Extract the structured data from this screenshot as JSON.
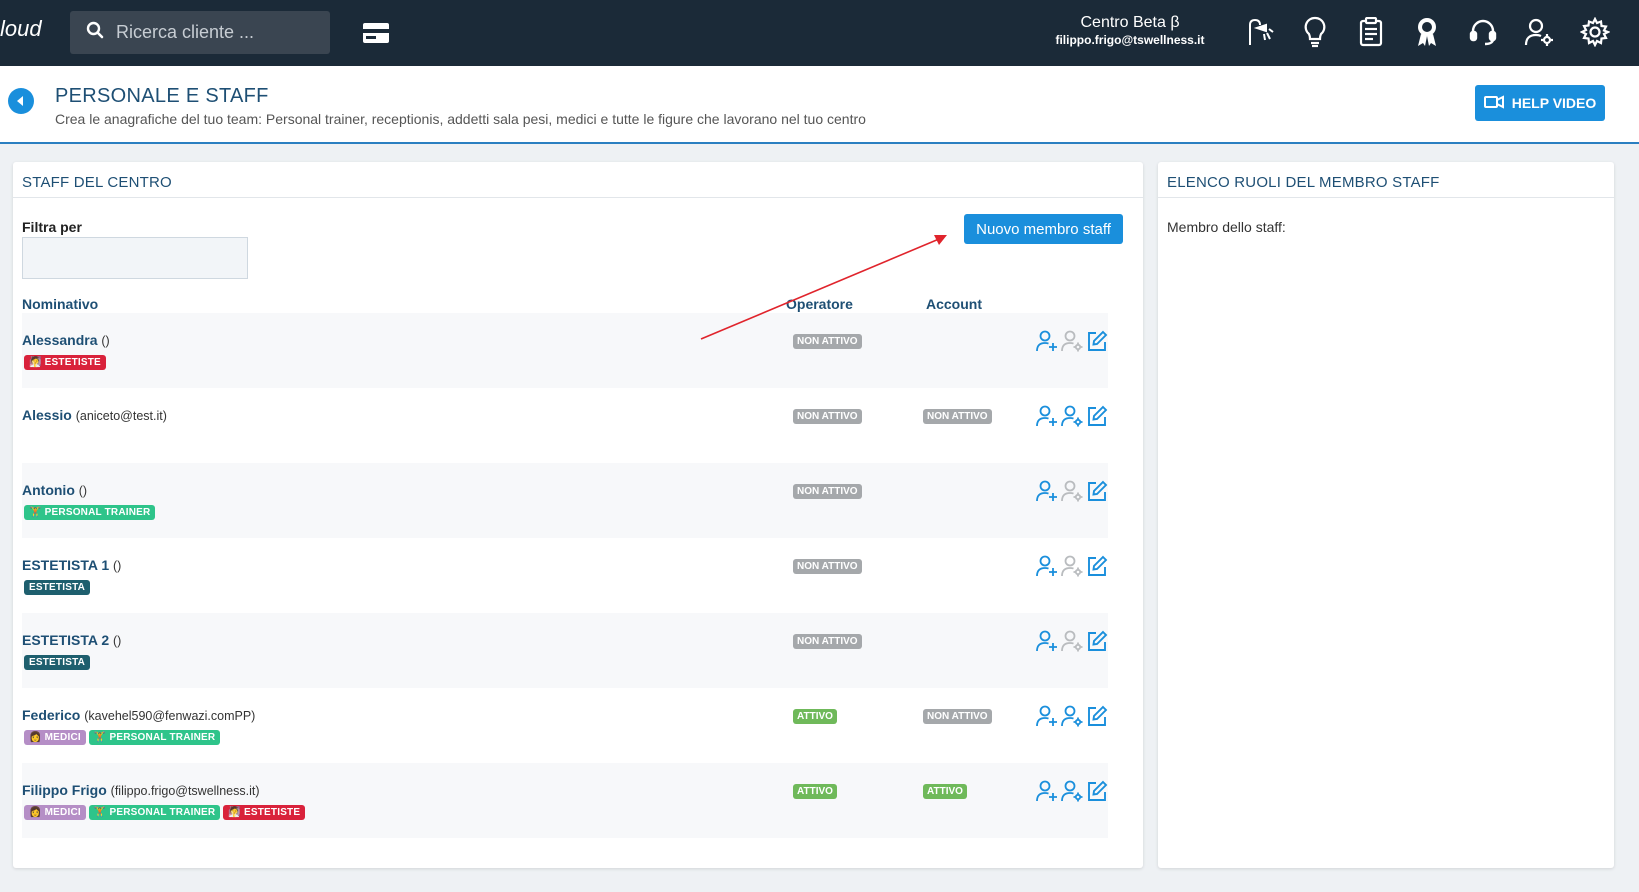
{
  "app": {
    "logo_text": "loud",
    "search_placeholder": "Ricerca cliente ...",
    "center_name": "Centro Beta β",
    "center_email": "filippo.frigo@tswellness.it",
    "top_icons": [
      "shower-icon",
      "lightbulb-icon",
      "clipboard-icon",
      "award-icon",
      "headset-icon",
      "user-cog-icon",
      "settings-icon"
    ]
  },
  "header": {
    "title": "PERSONALE E STAFF",
    "subtitle": "Crea le anagrafiche del tuo team: Personal trainer, receptionis, addetti sala pesi, medici e tutte le figure che lavorano nel tuo centro",
    "help_label": "HELP VIDEO"
  },
  "staff_panel": {
    "title": "STAFF DEL CENTRO",
    "filter_label": "Filtra per",
    "filter_value": "",
    "new_button": "Nuovo membro staff",
    "columns": {
      "name": "Nominativo",
      "operator": "Operatore",
      "account": "Account"
    },
    "rows": [
      {
        "name": "Alessandra",
        "email": "()",
        "tags": [
          {
            "label": "ESTETISTE",
            "color": "red",
            "icon": "🧖"
          }
        ],
        "operator": "NON ATTIVO",
        "account": ""
      },
      {
        "name": "Alessio",
        "email": "(aniceto@test.it)",
        "tags": [],
        "operator": "NON ATTIVO",
        "account": "NON ATTIVO"
      },
      {
        "name": "Antonio",
        "email": "()",
        "tags": [
          {
            "label": "PERSONAL TRAINER",
            "color": "green",
            "icon": "🏋"
          }
        ],
        "operator": "NON ATTIVO",
        "account": ""
      },
      {
        "name": "ESTETISTA 1",
        "email": "()",
        "tags": [
          {
            "label": "ESTETISTA",
            "color": "teal",
            "icon": ""
          }
        ],
        "operator": "NON ATTIVO",
        "account": ""
      },
      {
        "name": "ESTETISTA 2",
        "email": "()",
        "tags": [
          {
            "label": "ESTETISTA",
            "color": "teal",
            "icon": ""
          }
        ],
        "operator": "NON ATTIVO",
        "account": ""
      },
      {
        "name": "Federico",
        "email": "(kavehel590@fenwazi.comPP)",
        "tags": [
          {
            "label": "MEDICI",
            "color": "purple",
            "icon": "👩"
          },
          {
            "label": "PERSONAL TRAINER",
            "color": "green",
            "icon": "🏋"
          }
        ],
        "operator": "ATTIVO",
        "account": "NON ATTIVO"
      },
      {
        "name": "Filippo Frigo",
        "email": "(filippo.frigo@tswellness.it)",
        "tags": [
          {
            "label": "MEDICI",
            "color": "purple",
            "icon": "👩"
          },
          {
            "label": "PERSONAL TRAINER",
            "color": "green",
            "icon": "🏋"
          },
          {
            "label": "ESTETISTE",
            "color": "red",
            "icon": "🧖"
          }
        ],
        "operator": "ATTIVO",
        "account": "ATTIVO"
      }
    ]
  },
  "roles_panel": {
    "title": "ELENCO RUOLI DEL MEMBRO STAFF",
    "label": "Membro dello staff:"
  }
}
